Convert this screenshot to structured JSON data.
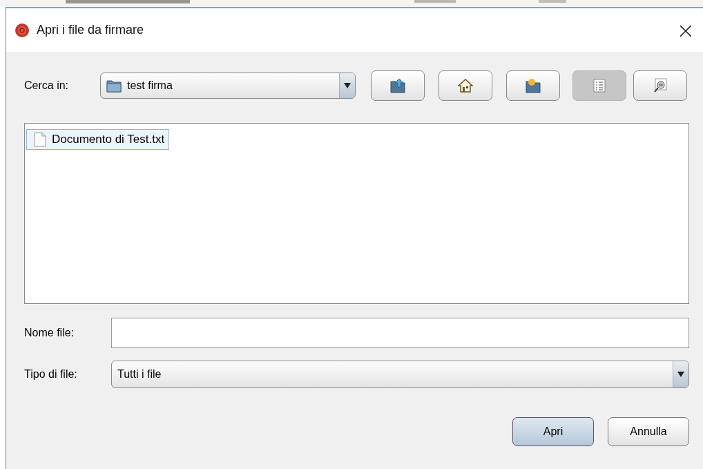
{
  "window": {
    "title": "Apri i file da firmare",
    "close": "×"
  },
  "look_in": {
    "label": "Cerca in:",
    "value": "test firma"
  },
  "toolbar": [
    {
      "kind": "up",
      "selected": false
    },
    {
      "kind": "home",
      "selected": false
    },
    {
      "kind": "newfolder",
      "selected": false
    },
    {
      "kind": "list",
      "selected": true
    },
    {
      "kind": "details",
      "selected": false
    }
  ],
  "files": [
    {
      "name": "Documento di Test.txt",
      "selected": true
    }
  ],
  "file_name": {
    "label": "Nome file:"
  },
  "file_type": {
    "label": "Tipo di file:",
    "value": "Tutti i file"
  },
  "buttons": [
    {
      "label": "Apri",
      "default": true
    },
    {
      "label": "Annulla",
      "default": false
    }
  ]
}
